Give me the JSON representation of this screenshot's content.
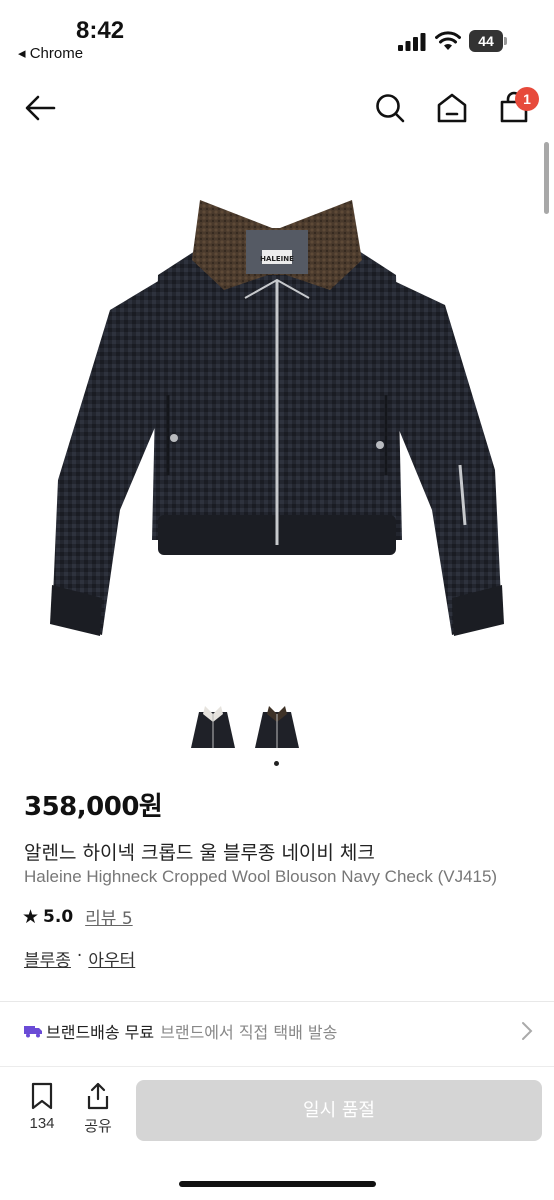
{
  "status": {
    "time": "8:42",
    "back_app": "◂ Chrome",
    "battery": "44"
  },
  "nav": {
    "cart_count": "1"
  },
  "product": {
    "price": "358,000원",
    "title_ko": "알렌느 하이넥 크롭드 울 블루종 네이비 체크",
    "title_en": "Haleine Highneck Cropped Wool Blouson Navy Check (VJ415)",
    "brand_tag": "HALEINE",
    "rating": "5.0",
    "review_label": "리뷰 5",
    "categories": [
      "블루종",
      "아우터"
    ],
    "category_separator": "·"
  },
  "shipping": {
    "title": "브랜드배송 무료",
    "subtitle": "브랜드에서 직접 택배 발송"
  },
  "bottom": {
    "bookmark_count": "134",
    "share_label": "공유",
    "soldout_label": "일시 품절"
  },
  "colors": {
    "badge": "#e74a3b",
    "truck": "#6a4bd6",
    "soldout": "#d5d5d5"
  }
}
